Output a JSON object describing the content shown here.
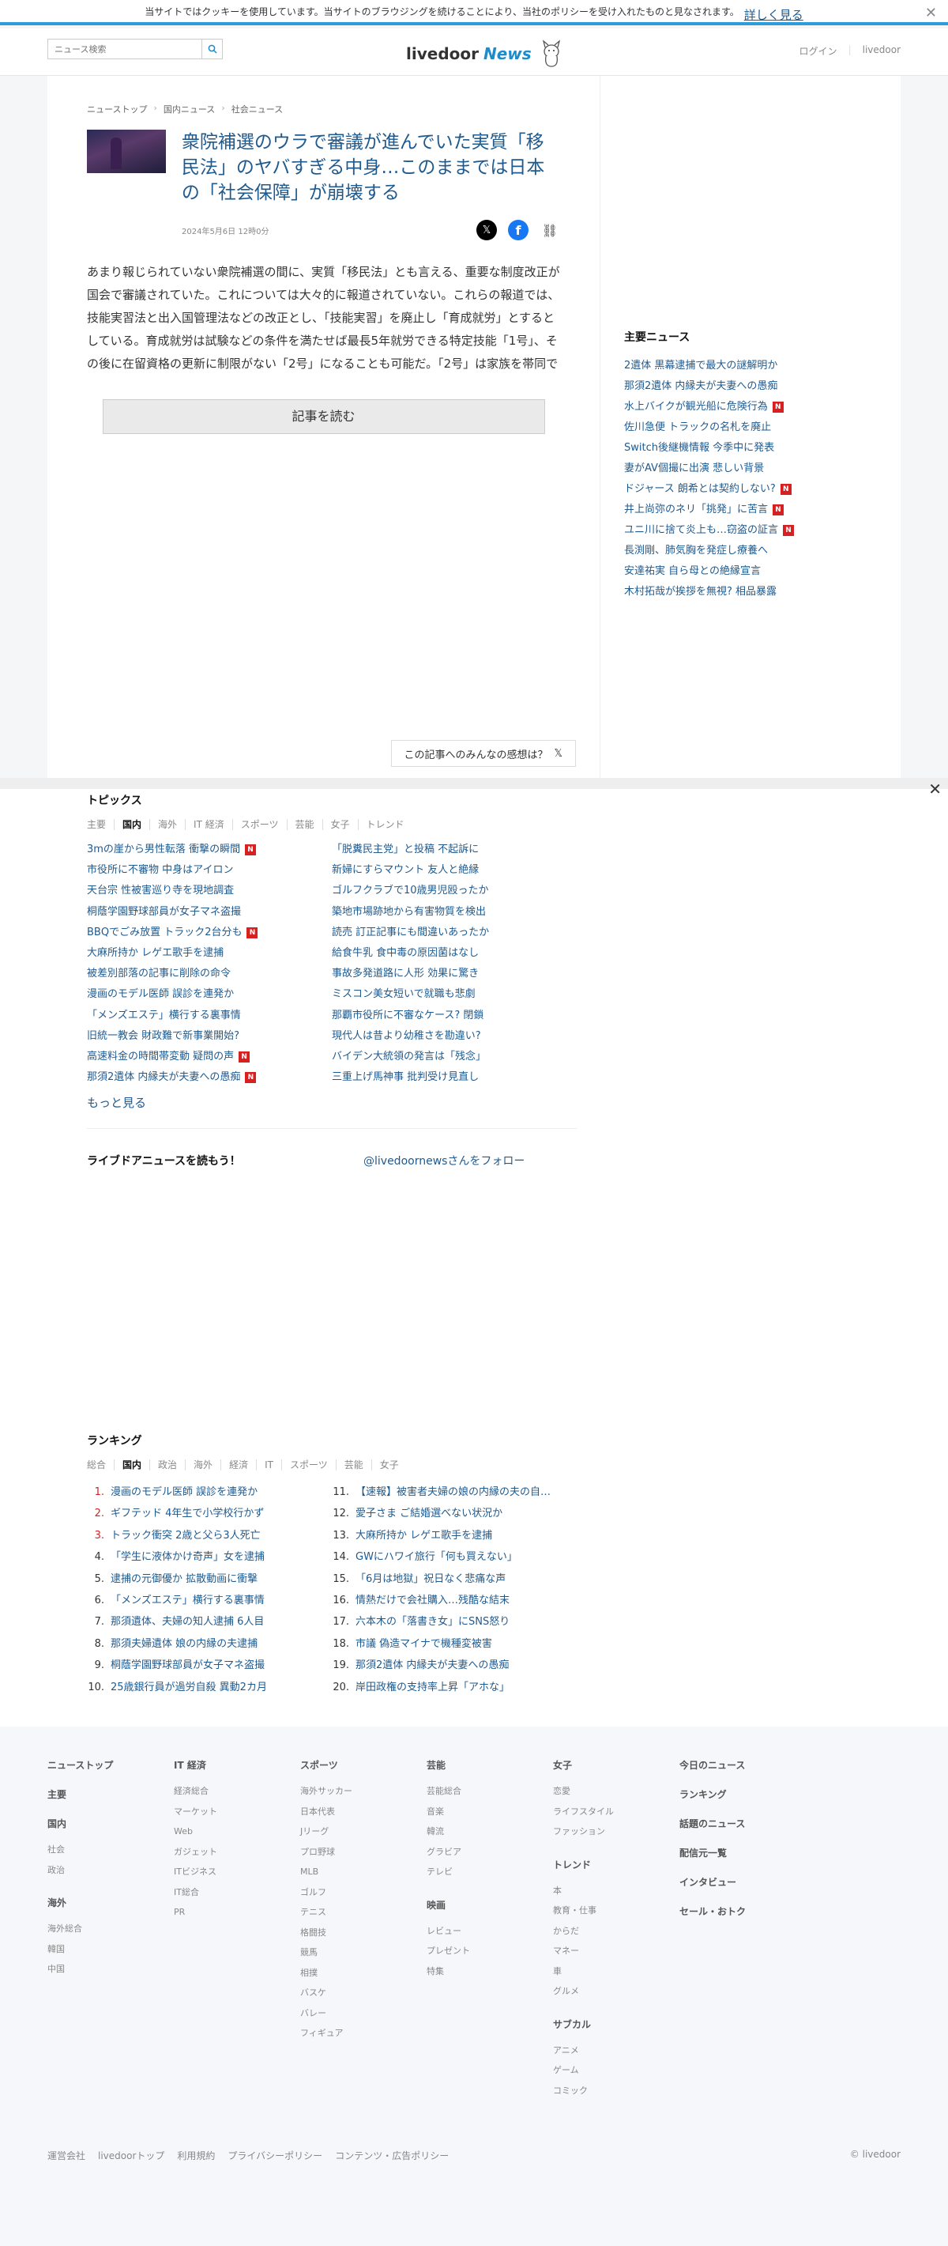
{
  "cookie": {
    "text": "当サイトではクッキーを使用しています。当サイトのブラウジングを続けることにより、当社のポリシーを受け入れたものと見なされます。",
    "more": "詳しく見る"
  },
  "header": {
    "search_placeholder": "ニュース検索",
    "logo": "livedoor",
    "logo_news": "News",
    "login": "ログイン",
    "livedoor": "livedoor"
  },
  "breadcrumb": [
    "ニューストップ",
    "国内ニュース",
    "社会ニュース"
  ],
  "article": {
    "title": "衆院補選のウラで審議が進んでいた実質「移民法」のヤバすぎる中身…このままでは日本の「社会保障」が崩壊する",
    "date": "2024年5月6日 12時0分",
    "body": "あまり報じられていない衆院補選の間に、実質「移民法」とも言える、重要な制度改正が国会で審議されていた。これについては大々的に報道されていない。これらの報道では、技能実習法と出入国管理法などの改正とし、「技能実習」を廃止し「育成就労」とするとしている。育成就労は試験などの条件を満たせば最長5年就労できる特定技能「1号」、その後に在留資格の更新に制限がない「2号」になることも可能だ。「2号」は家族を帯同で",
    "read_btn": "記事を読む",
    "feel": "この記事へのみんなの感想は？"
  },
  "side": {
    "title": "主要ニュース",
    "items": [
      {
        "t": "2遺体 黒幕逮捕で最大の謎解明か",
        "n": false
      },
      {
        "t": "那須2遺体 内縁夫が夫妻への愚痴",
        "n": false
      },
      {
        "t": "水上バイクが観光船に危険行為",
        "n": true
      },
      {
        "t": "佐川急便 トラックの名札を廃止",
        "n": false
      },
      {
        "t": "Switch後継機情報 今季中に発表",
        "n": false
      },
      {
        "t": "妻がAV個撮に出演 悲しい背景",
        "n": false
      },
      {
        "t": "ドジャース 朗希とは契約しない?",
        "n": true
      },
      {
        "t": "井上尚弥のネリ「挑発」に苦言",
        "n": true
      },
      {
        "t": "ユニ川に捨て炎上も…窃盗の証言",
        "n": true
      },
      {
        "t": "長渕剛、肺気胸を発症し療養へ",
        "n": false
      },
      {
        "t": "安達祐実 自ら母との絶縁宣言",
        "n": false
      },
      {
        "t": "木村拓哉が挨拶を無視? 相品暴露",
        "n": false
      }
    ]
  },
  "topics": {
    "title": "トピックス",
    "tabs": [
      "主要",
      "国内",
      "海外",
      "IT 経済",
      "スポーツ",
      "芸能",
      "女子",
      "トレンド"
    ],
    "active": 1,
    "left": [
      {
        "t": "3mの崖から男性転落 衝撃の瞬間",
        "n": true
      },
      {
        "t": "市役所に不審物 中身はアイロン",
        "n": false
      },
      {
        "t": "天台宗 性被害巡り寺を現地調査",
        "n": false
      },
      {
        "t": "桐蔭学園野球部員が女子マネ盗撮",
        "n": false
      },
      {
        "t": "BBQでごみ放置 トラック2台分も",
        "n": true
      },
      {
        "t": "大麻所持か レゲエ歌手を逮捕",
        "n": false
      },
      {
        "t": "被差別部落の記事に削除の命令",
        "n": false
      },
      {
        "t": "漫画のモデル医師 誤診を連発か",
        "n": false
      },
      {
        "t": "「メンズエステ」横行する裏事情",
        "n": false
      },
      {
        "t": "旧統一教会 財政難で新事業開始?",
        "n": false
      },
      {
        "t": "高速料金の時間帯変動 疑問の声",
        "n": true
      },
      {
        "t": "那須2遺体 内縁夫が夫妻への愚痴",
        "n": true
      }
    ],
    "right": [
      {
        "t": "「脱糞民主党」と投稿 不起訴に",
        "n": false
      },
      {
        "t": "新婦にすらマウント 友人と絶縁",
        "n": false
      },
      {
        "t": "ゴルフクラブで10歳男児殴ったか",
        "n": false
      },
      {
        "t": "築地市場跡地から有害物質を検出",
        "n": false
      },
      {
        "t": "読売 訂正記事にも間違いあったか",
        "n": false
      },
      {
        "t": "給食牛乳 食中毒の原因菌はなし",
        "n": false
      },
      {
        "t": "事故多発道路に人形 効果に驚き",
        "n": false
      },
      {
        "t": "ミスコン美女短いで就職も悲劇",
        "n": false
      },
      {
        "t": "那覇市役所に不審なケース? 閉鎖",
        "n": false
      },
      {
        "t": "現代人は昔より幼稚さを勘違い?",
        "n": false
      },
      {
        "t": "バイデン大統領の発言は「残念」",
        "n": false
      },
      {
        "t": "三重上げ馬神事 批判受け見直し",
        "n": false
      }
    ],
    "more": "もっと見る"
  },
  "follow": {
    "title": "ライブドアニュースを読もう！",
    "link": "@livedoornewsさんをフォロー"
  },
  "ranking": {
    "title": "ランキング",
    "tabs": [
      "総合",
      "国内",
      "政治",
      "海外",
      "経済",
      "IT",
      "スポーツ",
      "芸能",
      "女子"
    ],
    "active": 1,
    "left": [
      {
        "n": "1.",
        "t": "漫画のモデル医師 誤診を連発か"
      },
      {
        "n": "2.",
        "t": "ギフテッド 4年生で小学校行かず"
      },
      {
        "n": "3.",
        "t": "トラック衝突 2歳と父ら3人死亡"
      },
      {
        "n": "4.",
        "t": "「学生に液体かけ奇声」女を逮捕"
      },
      {
        "n": "5.",
        "t": "逮捕の元御優か 拡散動画に衝撃"
      },
      {
        "n": "6.",
        "t": "「メンズエステ」横行する裏事情"
      },
      {
        "n": "7.",
        "t": "那須遺体、夫婦の知人逮捕 6人目"
      },
      {
        "n": "8.",
        "t": "那須夫婦遺体 娘の内縁の夫逮捕"
      },
      {
        "n": "9.",
        "t": "桐蔭学園野球部員が女子マネ盗撮"
      },
      {
        "n": "10.",
        "t": "25歳銀行員が過労自殺 異動2カ月"
      }
    ],
    "right": [
      {
        "n": "11.",
        "t": "【速報】被害者夫婦の娘の内縁の夫の自…"
      },
      {
        "n": "12.",
        "t": "愛子さま ご結婚選べない状況か"
      },
      {
        "n": "13.",
        "t": "大麻所持か レゲエ歌手を逮捕"
      },
      {
        "n": "14.",
        "t": "GWにハワイ旅行「何も買えない」"
      },
      {
        "n": "15.",
        "t": "「6月は地獄」祝日なく悲痛な声"
      },
      {
        "n": "16.",
        "t": "情熱だけで会社購入…残酷な結末"
      },
      {
        "n": "17.",
        "t": "六本木の「落書き女」にSNS怒り"
      },
      {
        "n": "18.",
        "t": "市議 偽造マイナで機種変被害"
      },
      {
        "n": "19.",
        "t": "那須2遺体 内縁夫が夫妻への愚痴"
      },
      {
        "n": "20.",
        "t": "岸田政権の支持率上昇「アホな」"
      }
    ]
  },
  "footer": {
    "col1": {
      "heads": [
        "ニューストップ",
        "主要",
        "国内",
        "海外"
      ],
      "kokunai": [
        "社会",
        "政治"
      ],
      "kaigai": [
        "海外総合",
        "韓国",
        "中国"
      ]
    },
    "col2": {
      "head": "IT 経済",
      "items": [
        "経済総合",
        "マーケット",
        "Web",
        "ガジェット",
        "ITビジネス",
        "IT総合",
        "PR"
      ]
    },
    "col3": {
      "head": "スポーツ",
      "items": [
        "海外サッカー",
        "日本代表",
        "Jリーグ",
        "プロ野球",
        "MLB",
        "ゴルフ",
        "テニス",
        "格闘技",
        "競馬",
        "相撲",
        "バスケ",
        "バレー",
        "フィギュア"
      ]
    },
    "col4": {
      "head": "芸能",
      "items": [
        "芸能総合",
        "音楽",
        "韓流",
        "グラビア",
        "テレビ"
      ],
      "head2": "映画",
      "items2": [
        "レビュー",
        "プレゼント",
        "特集"
      ]
    },
    "col5": {
      "head": "女子",
      "items": [
        "恋愛",
        "ライフスタイル",
        "ファッション"
      ],
      "head2": "トレンド",
      "items2": [
        "本",
        "教育・仕事",
        "からだ",
        "マネー",
        "車",
        "グルメ"
      ],
      "head3": "サブカル",
      "items3": [
        "アニメ",
        "ゲーム",
        "コミック"
      ]
    },
    "col6": {
      "heads": [
        "今日のニュース",
        "ランキング",
        "話題のニュース",
        "配信元一覧",
        "インタビュー",
        "セール・おトク"
      ]
    },
    "bottom_links": [
      "運営会社",
      "livedoorトップ",
      "利用規約",
      "プライバシーポリシー",
      "コンテンツ・広告ポリシー"
    ],
    "copy": "© livedoor"
  }
}
